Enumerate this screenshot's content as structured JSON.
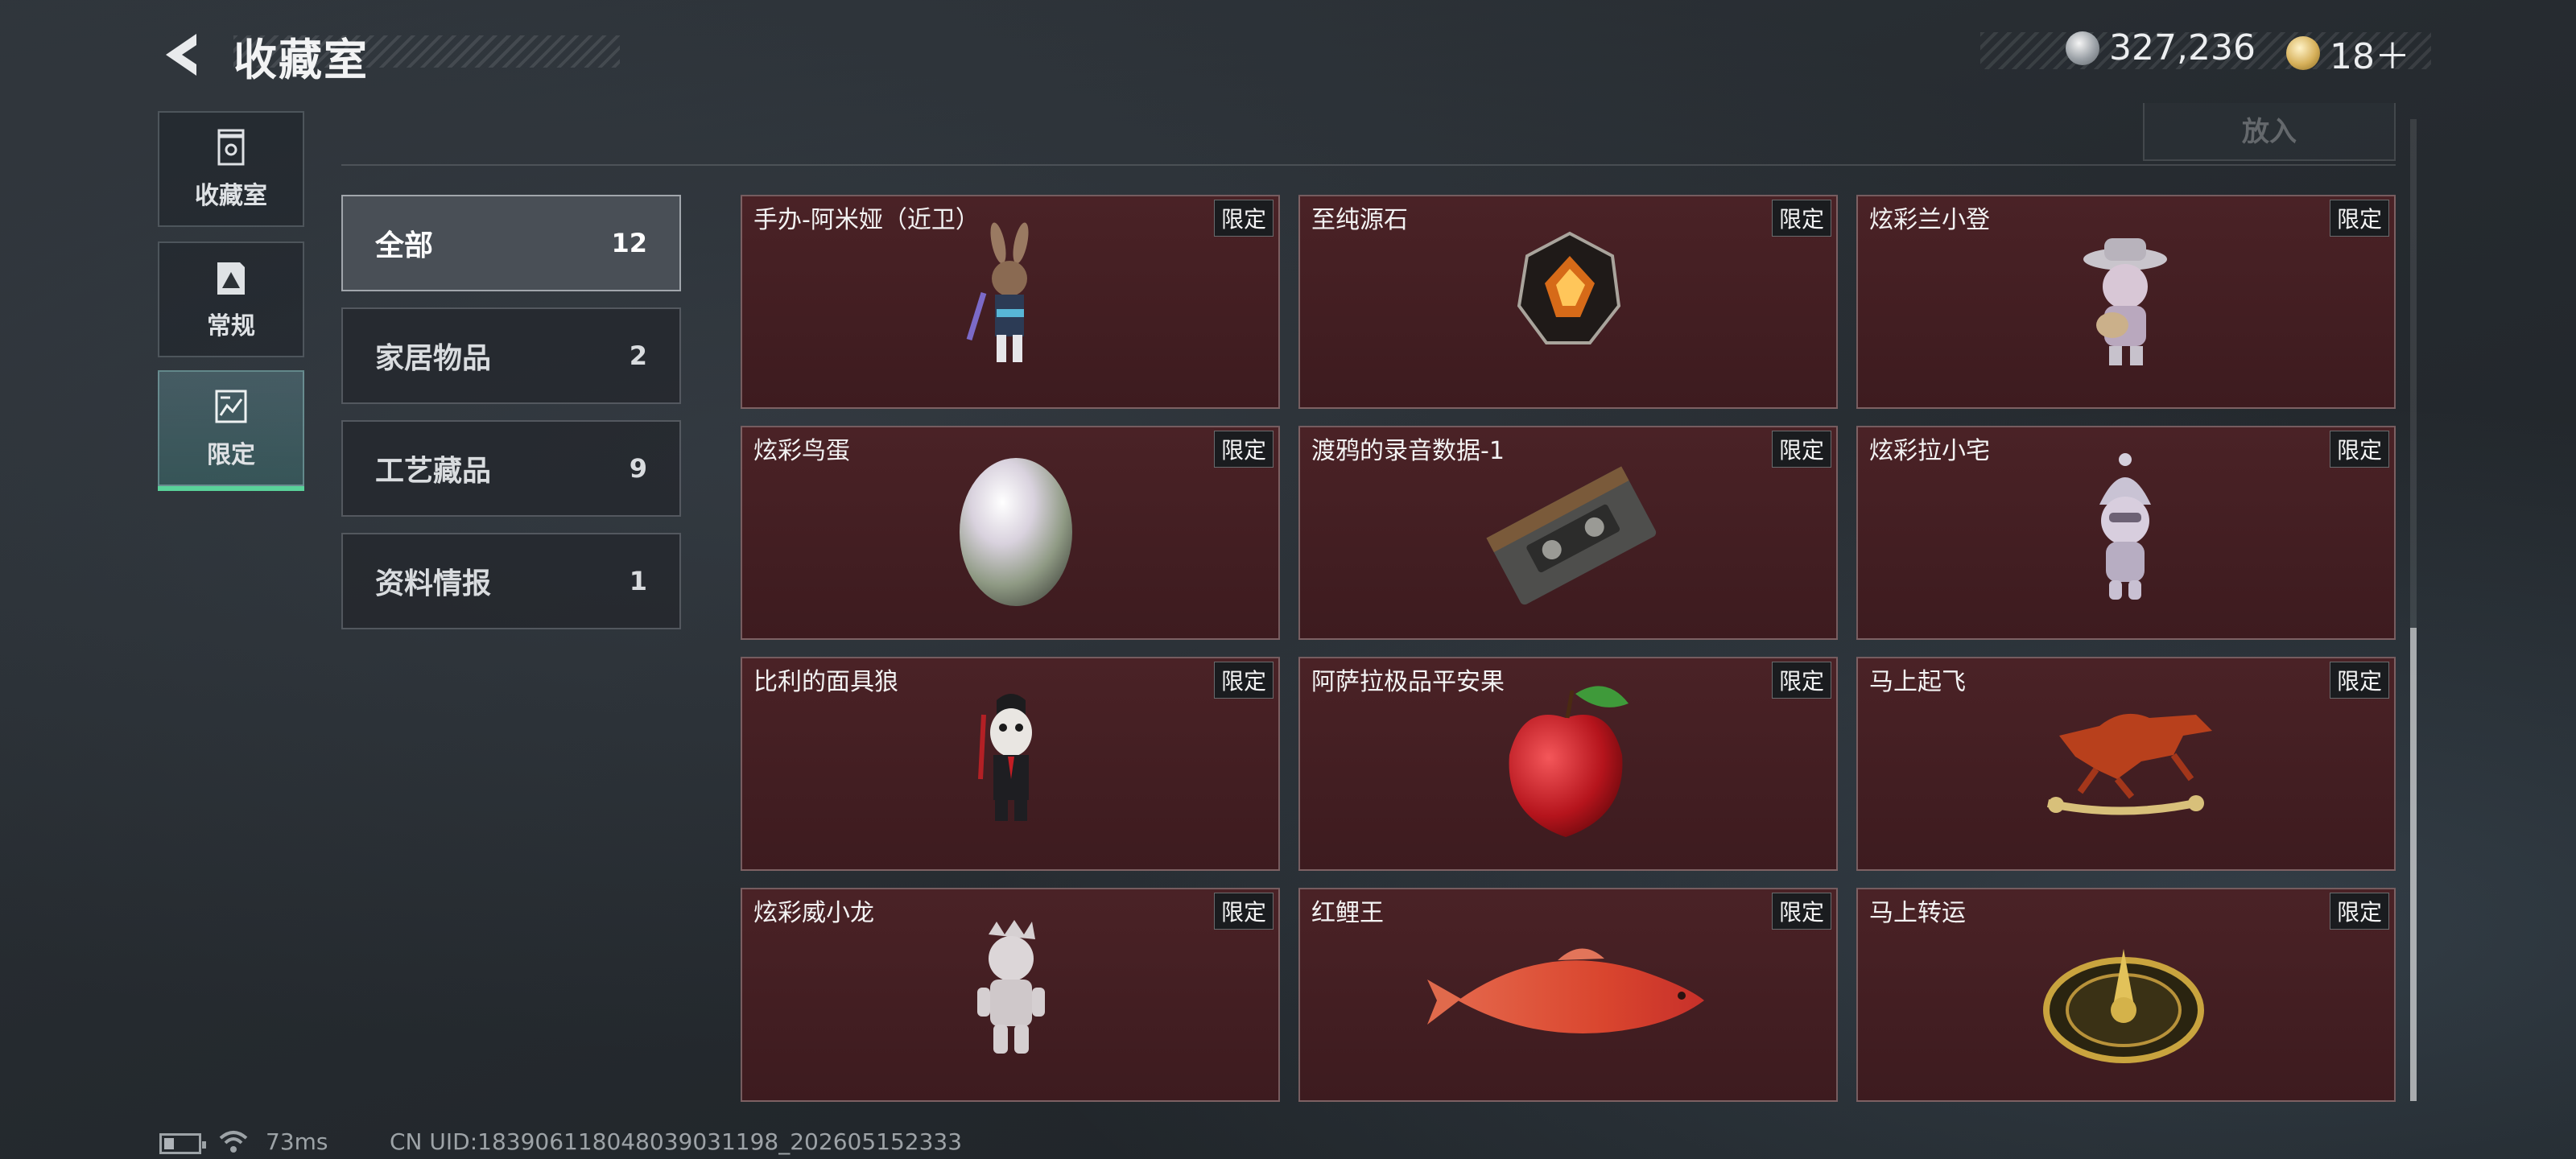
{
  "header": {
    "title": "收藏室",
    "currency_coin": "327,236",
    "currency_token": "18＋"
  },
  "side_nav": [
    {
      "label": "收藏室",
      "icon": "trash-can-icon",
      "active": false
    },
    {
      "label": "常规",
      "icon": "picture-frame-icon",
      "active": false
    },
    {
      "label": "限定",
      "icon": "limited-frame-icon",
      "active": true
    }
  ],
  "place_button": "放入",
  "categories": [
    {
      "label": "全部",
      "count": "12",
      "active": true
    },
    {
      "label": "家居物品",
      "count": "2",
      "active": false
    },
    {
      "label": "工艺藏品",
      "count": "9",
      "active": false
    },
    {
      "label": "资料情报",
      "count": "1",
      "active": false
    }
  ],
  "items": [
    {
      "name": "手办-阿米娅（近卫）",
      "tag": "限定",
      "art": "figure-amiya-icon"
    },
    {
      "name": "至纯源石",
      "tag": "限定",
      "art": "originium-crystal-icon"
    },
    {
      "name": "炫彩兰小登",
      "tag": "限定",
      "art": "figure-guitar-icon"
    },
    {
      "name": "炫彩鸟蛋",
      "tag": "限定",
      "art": "pearl-egg-icon"
    },
    {
      "name": "渡鸦的录音数据-1",
      "tag": "限定",
      "art": "cassette-tape-icon"
    },
    {
      "name": "炫彩拉小宅",
      "tag": "限定",
      "art": "figure-hood-icon"
    },
    {
      "name": "比利的面具狼",
      "tag": "限定",
      "art": "figure-mask-icon"
    },
    {
      "name": "阿萨拉极品平安果",
      "tag": "限定",
      "art": "red-apple-icon"
    },
    {
      "name": "马上起飞",
      "tag": "限定",
      "art": "horse-statue-icon"
    },
    {
      "name": "炫彩威小龙",
      "tag": "限定",
      "art": "figure-dragon-icon"
    },
    {
      "name": "红鲤王",
      "tag": "限定",
      "art": "red-carp-icon"
    },
    {
      "name": "马上转运",
      "tag": "限定",
      "art": "gold-compass-icon"
    }
  ],
  "status_bar": {
    "ping": "73ms",
    "uid": "CN UID:18390611804803903119​8_202605152333"
  }
}
